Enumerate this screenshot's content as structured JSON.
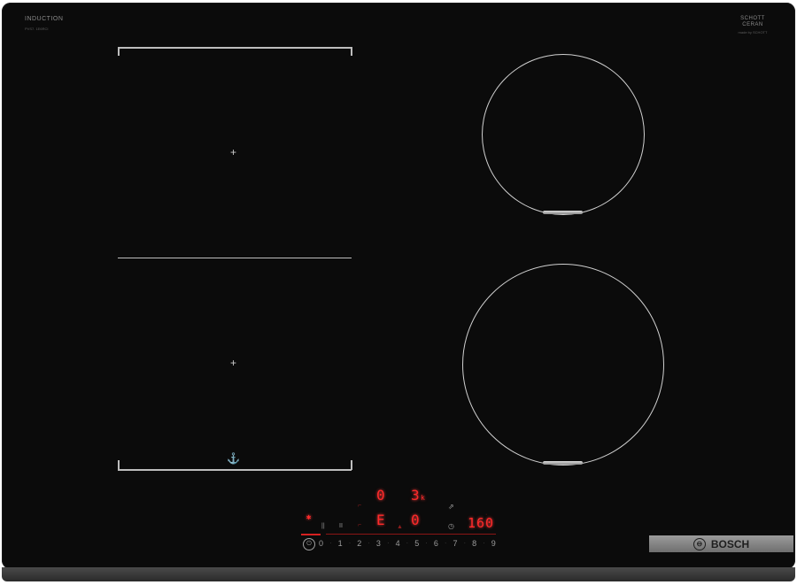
{
  "branding": {
    "induction_label": "INDUCTION",
    "induction_sub": "PVS7. 1E6RCI",
    "glass_label": "SCHOTT CERAN",
    "glass_sub": "made by SCHOTT",
    "brand": "BOSCH"
  },
  "display": {
    "zone_front_left_level": "0",
    "zone_rear_right_level": "3",
    "zone_rear_right_sub": "k",
    "heat_indicator": "E",
    "zone_front_right_level": "0",
    "timer_value": "160",
    "small_labels": [
      "||",
      "II"
    ],
    "slider_values": [
      "0",
      "1",
      "2",
      "3",
      "4",
      "5",
      "6",
      "7",
      "8",
      "9"
    ]
  },
  "colors": {
    "glass": "#0b0b0b",
    "display_red": "#ff2a2a",
    "zone_outline": "#d0d0d0",
    "brand_bar": "#8a8a8a"
  }
}
